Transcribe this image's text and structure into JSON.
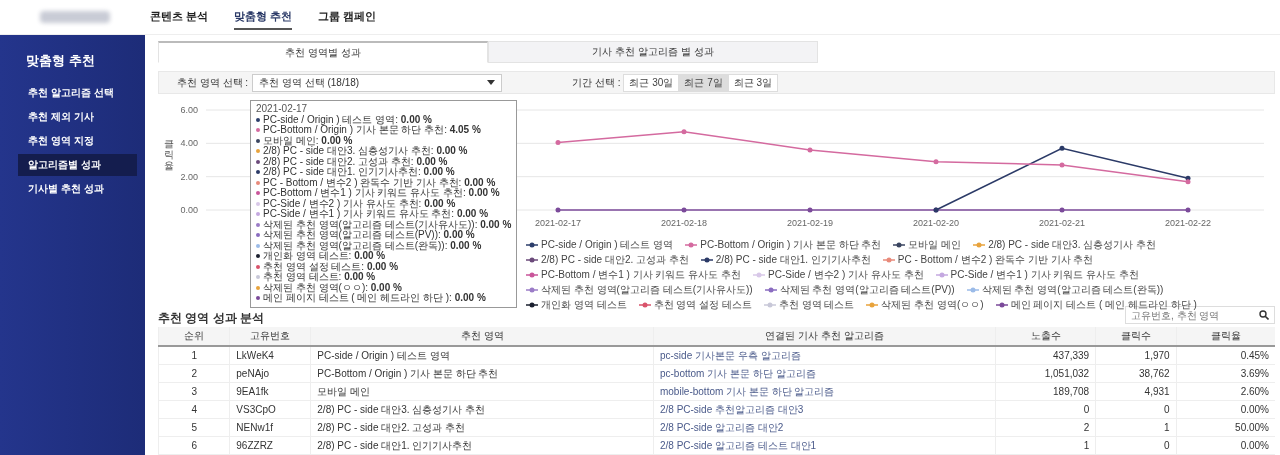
{
  "top_nav": {
    "items": [
      {
        "label": "콘텐츠 분석",
        "selected": false
      },
      {
        "label": "맞춤형 추천",
        "selected": true
      },
      {
        "label": "그룹 캠페인",
        "selected": false
      }
    ]
  },
  "sidebar": {
    "title": "맞춤형 추천",
    "items": [
      {
        "label": "추천 알고리즘 선택",
        "selected": false
      },
      {
        "label": "추천 제외 기사",
        "selected": false
      },
      {
        "label": "추천 영역 지정",
        "selected": false
      },
      {
        "label": "알고리즘별 성과",
        "selected": true
      },
      {
        "label": "기사별 추천 성과",
        "selected": false
      }
    ]
  },
  "tabs": [
    {
      "label": "추천 영역별 성과",
      "selected": true
    },
    {
      "label": "기사 추천 알고리즘 별 성과",
      "selected": false
    }
  ],
  "filters": {
    "area_label": "추천 영역 선택 :",
    "area_value": "추천 영역 선택 (18/18)",
    "period_label": "기간 선택 :",
    "periods": [
      {
        "label": "최근 30일",
        "selected": false
      },
      {
        "label": "최근 7일",
        "selected": true
      },
      {
        "label": "최근 3일",
        "selected": false
      }
    ]
  },
  "chart": {
    "chart_data": {
      "type": "line",
      "ylabel": "클릭율",
      "categories": [
        "2021-02-17",
        "2021-02-18",
        "2021-02-19",
        "2021-02-20",
        "2021-02-21",
        "2021-02-22"
      ],
      "ylim": [
        0,
        6
      ],
      "yticks": [
        {
          "value": 0,
          "label": "0.00"
        },
        {
          "value": 2,
          "label": "2.00"
        },
        {
          "value": 4,
          "label": "4.00"
        },
        {
          "value": 6,
          "label": "6.00"
        }
      ],
      "series": [
        {
          "name": "PC-side / Origin ) 테스트 영역",
          "color": "#2c3e6b",
          "values": [
            null,
            null,
            null,
            null,
            null,
            null
          ]
        },
        {
          "name": "PC-Bottom / Origin ) 기사 본문 하단 추천",
          "color": "#d46a9f",
          "values": [
            4.05,
            4.7,
            3.6,
            2.9,
            2.7,
            1.7
          ]
        },
        {
          "name": "모바일 메인",
          "color": "#3a4560",
          "values": [
            null,
            null,
            null,
            null,
            null,
            null
          ]
        },
        {
          "name": "2/8) PC - side 대안3. 심층성기사 추천",
          "color": "#e8a33c",
          "values": [
            null,
            null,
            null,
            null,
            null,
            null
          ]
        },
        {
          "name": "2/8) PC - side 대안2. 고성과 추천",
          "color": "#6b4a7a",
          "values": [
            null,
            null,
            null,
            null,
            null,
            null
          ]
        },
        {
          "name": "2/8) PC - side 대안1. 인기기사추천",
          "color": "#2b3a67",
          "values": [
            null,
            null,
            null,
            0,
            3.7,
            1.9
          ]
        },
        {
          "name": "PC - Bottom / 변수2 ) 완독수 기반 기사 추천",
          "color": "#e88a7a",
          "values": [
            null,
            null,
            null,
            null,
            null,
            null
          ]
        },
        {
          "name": "PC-Bottom / 변수1 ) 기사 키워드 유사도 추천",
          "color": "#c9559a",
          "values": [
            null,
            null,
            null,
            null,
            null,
            null
          ]
        },
        {
          "name": "PC-Side / 변수2 ) 기사 유사도 추천",
          "color": "#d8c8e8",
          "values": [
            null,
            null,
            null,
            null,
            null,
            null
          ]
        },
        {
          "name": "PC-Side / 변수1 ) 기사 키워드 유사도 추천",
          "color": "#c4a8e0",
          "values": [
            null,
            null,
            null,
            null,
            null,
            null
          ]
        },
        {
          "name": "삭제된 추천 영역(알고리즘 테스트(기사유사도))",
          "color": "#9b7cc7",
          "values": [
            null,
            null,
            null,
            null,
            null,
            null
          ]
        },
        {
          "name": "삭제된 추천 영역(알고리즘 테스트(PV))",
          "color": "#8a6cc0",
          "values": [
            null,
            null,
            null,
            null,
            null,
            null
          ]
        },
        {
          "name": "삭제된 추천 영역(알고리즘 테스트(완독))",
          "color": "#9bbbe8",
          "values": [
            null,
            null,
            null,
            null,
            null,
            null
          ]
        },
        {
          "name": "개인화 영역 테스트",
          "color": "#1a1f2e",
          "values": [
            null,
            null,
            null,
            null,
            null,
            null
          ]
        },
        {
          "name": "추천 영역 설정 테스트",
          "color": "#d9536b",
          "values": [
            null,
            null,
            null,
            null,
            null,
            null
          ]
        },
        {
          "name": "추천 영역 테스트",
          "color": "#c8c8d8",
          "values": [
            null,
            null,
            null,
            null,
            null,
            null
          ]
        },
        {
          "name": "삭제된 추천 영역(ㅇㅇ)",
          "color": "#e8a33c",
          "values": [
            null,
            null,
            null,
            null,
            null,
            null
          ]
        },
        {
          "name": "메인 페이지 테스트 ( 메인 헤드라인 하단 )",
          "color": "#7b4a9a",
          "values": [
            0,
            0,
            0,
            0,
            0,
            0
          ]
        }
      ]
    },
    "tooltip": {
      "date": "2021-02-17",
      "items": [
        {
          "text": "PC-side / Origin ) 테스트 영역: **0.00 %**",
          "color": "#2c3e6b"
        },
        {
          "text": "PC-Bottom / Origin ) 기사 본문 하단 추천: **4.05 %**",
          "color": "#d46a9f"
        },
        {
          "text": "모바일 메인: **0.00 %**",
          "color": "#3a4560"
        },
        {
          "text": "2/8) PC - side 대안3. 심층성기사 추천: **0.00 %**",
          "color": "#e8a33c"
        },
        {
          "text": "2/8) PC - side 대안2. 고성과 추천: **0.00 %**",
          "color": "#6b4a7a"
        },
        {
          "text": "2/8) PC - side 대안1. 인기기사추천: **0.00 %**",
          "color": "#2b3a67"
        },
        {
          "text": "PC - Bottom / 변수2 ) 완독수 기반 기사 추천: **0.00 %**",
          "color": "#e88a7a"
        },
        {
          "text": "PC-Bottom / 변수1 ) 기사 키워드 유사도 추천: **0.00 %**",
          "color": "#c9559a"
        },
        {
          "text": "PC-Side / 변수2 ) 기사 유사도 추천: **0.00 %**",
          "color": "#d8c8e8"
        },
        {
          "text": "PC-Side / 변수1 ) 기사 키워드 유사도 추천: **0.00 %**",
          "color": "#c4a8e0"
        },
        {
          "text": "삭제된 추천 영역(알고리즘 테스트(기사유사도)): **0.00 %**",
          "color": "#9b7cc7"
        },
        {
          "text": "삭제된 추천 영역(알고리즘 테스트(PV)): **0.00 %**",
          "color": "#8a6cc0"
        },
        {
          "text": "삭제된 추천 영역(알고리즘 테스트(완독)): **0.00 %**",
          "color": "#9bbbe8"
        },
        {
          "text": "개인화 영역 테스트: **0.00 %**",
          "color": "#1a1f2e"
        },
        {
          "text": "추천 영역 설정 테스트: **0.00 %**",
          "color": "#d9536b"
        },
        {
          "text": "추천 영역 테스트: **0.00 %**",
          "color": "#c8c8d8"
        },
        {
          "text": "삭제된 추천 영역(ㅇㅇ): **0.00 %**",
          "color": "#e8a33c"
        },
        {
          "text": "메인 페이지 테스트 ( 메인 헤드라인 하단 ): **0.00 %**",
          "color": "#7b4a9a"
        }
      ]
    }
  },
  "table": {
    "title": "추천 영역 성과 분석",
    "search": {
      "placeholder": "고유번호, 추천 영역"
    },
    "columns": [
      "순위",
      "고유번호",
      "추천 영역",
      "연결된 기사 추천 알고리즘",
      "노출수",
      "클릭수",
      "클릭율"
    ],
    "rows": [
      [
        "1",
        "LkWeK4",
        "PC-side / Origin ) 테스트 영역",
        "pc-side 기사본문 우측 알고리즘",
        "437,339",
        "1,970",
        "0.45%"
      ],
      [
        "2",
        "peNAjo",
        "PC-Bottom / Origin ) 기사 본문 하단 추천",
        "pc-bottom 기사 본문 하단 알고리즘",
        "1,051,032",
        "38,762",
        "3.69%"
      ],
      [
        "3",
        "9EA1fk",
        "모바일 메인",
        "mobile-bottom 기사 본문 하단 알고리즘",
        "189,708",
        "4,931",
        "2.60%"
      ],
      [
        "4",
        "VS3CpO",
        "2/8) PC - side 대안3. 심층성기사 추천",
        "2/8 PC-side 추천알고리즘 대안3",
        "0",
        "0",
        "0.00%"
      ],
      [
        "5",
        "NENw1f",
        "2/8) PC - side 대안2. 고성과 추천",
        "2/8 PC-side 알고리즘 대안2",
        "2",
        "1",
        "50.00%"
      ],
      [
        "6",
        "96ZZRZ",
        "2/8) PC - side 대안1. 인기기사추천",
        "2/8 PC-side 알고리즘 테스트 대안1",
        "1",
        "0",
        "0.00%"
      ]
    ]
  }
}
